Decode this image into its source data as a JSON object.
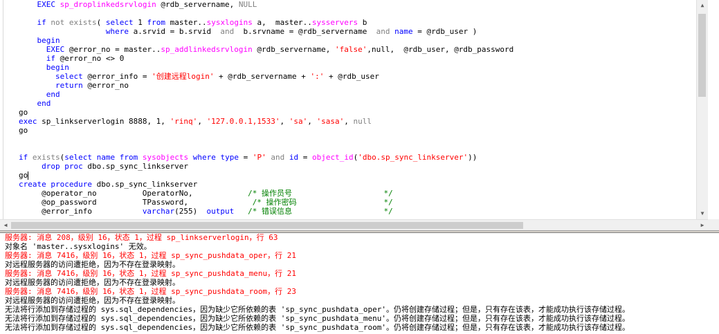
{
  "editor": {
    "lines": [
      [
        {
          "t": "    ",
          "c": "m"
        },
        {
          "t": "EXEC",
          "c": "k"
        },
        {
          "t": " ",
          "c": "m"
        },
        {
          "t": "sp_droplinkedsrvlogin",
          "c": "f"
        },
        {
          "t": " @rdb_servername, ",
          "c": "m"
        },
        {
          "t": "NULL",
          "c": "n"
        }
      ],
      [
        {
          "t": "",
          "c": "m"
        }
      ],
      [
        {
          "t": "    ",
          "c": "m"
        },
        {
          "t": "if",
          "c": "k"
        },
        {
          "t": " ",
          "c": "m"
        },
        {
          "t": "not exists",
          "c": "n"
        },
        {
          "t": "( ",
          "c": "m"
        },
        {
          "t": "select",
          "c": "k"
        },
        {
          "t": " 1 ",
          "c": "m"
        },
        {
          "t": "from",
          "c": "k"
        },
        {
          "t": " master..",
          "c": "m"
        },
        {
          "t": "sysxlogins",
          "c": "f"
        },
        {
          "t": " a,  master..",
          "c": "m"
        },
        {
          "t": "sysservers",
          "c": "f"
        },
        {
          "t": " b",
          "c": "m"
        }
      ],
      [
        {
          "t": "                   ",
          "c": "m"
        },
        {
          "t": "where",
          "c": "k"
        },
        {
          "t": " a.srvid = b.srvid  ",
          "c": "m"
        },
        {
          "t": "and",
          "c": "n"
        },
        {
          "t": "  b.srvname = @rdb_servername  ",
          "c": "m"
        },
        {
          "t": "and",
          "c": "n"
        },
        {
          "t": " ",
          "c": "m"
        },
        {
          "t": "name",
          "c": "k"
        },
        {
          "t": " = @rdb_user )",
          "c": "m"
        }
      ],
      [
        {
          "t": "    ",
          "c": "m"
        },
        {
          "t": "begin",
          "c": "k"
        }
      ],
      [
        {
          "t": "      ",
          "c": "m"
        },
        {
          "t": "EXEC",
          "c": "k"
        },
        {
          "t": " @error_no = master..",
          "c": "m"
        },
        {
          "t": "sp_addlinkedsrvlogin",
          "c": "f"
        },
        {
          "t": " @rdb_servername, ",
          "c": "m"
        },
        {
          "t": "'false'",
          "c": "s"
        },
        {
          "t": ",null,  @rdb_user, @rdb_password",
          "c": "m"
        }
      ],
      [
        {
          "t": "      ",
          "c": "m"
        },
        {
          "t": "if",
          "c": "k"
        },
        {
          "t": " @error_no <> 0",
          "c": "m"
        }
      ],
      [
        {
          "t": "      ",
          "c": "m"
        },
        {
          "t": "begin",
          "c": "k"
        }
      ],
      [
        {
          "t": "        ",
          "c": "m"
        },
        {
          "t": "select",
          "c": "k"
        },
        {
          "t": " @error_info = ",
          "c": "m"
        },
        {
          "t": "'创建远程login'",
          "c": "s"
        },
        {
          "t": " + @rdb_servername + ",
          "c": "m"
        },
        {
          "t": "':'",
          "c": "s"
        },
        {
          "t": " + @rdb_user",
          "c": "m"
        }
      ],
      [
        {
          "t": "        ",
          "c": "m"
        },
        {
          "t": "return",
          "c": "k"
        },
        {
          "t": " @error_no",
          "c": "m"
        }
      ],
      [
        {
          "t": "      ",
          "c": "m"
        },
        {
          "t": "end",
          "c": "k"
        }
      ],
      [
        {
          "t": "    ",
          "c": "m"
        },
        {
          "t": "end",
          "c": "k"
        }
      ],
      [
        {
          "t": "go",
          "c": "m"
        }
      ],
      [
        {
          "t": "exec",
          "c": "k"
        },
        {
          "t": " sp_linkserverlogin 8888, 1, ",
          "c": "m"
        },
        {
          "t": "'rinq'",
          "c": "s"
        },
        {
          "t": ", ",
          "c": "m"
        },
        {
          "t": "'127.0.0.1,1533'",
          "c": "s"
        },
        {
          "t": ", ",
          "c": "m"
        },
        {
          "t": "'sa'",
          "c": "s"
        },
        {
          "t": ", ",
          "c": "m"
        },
        {
          "t": "'sasa'",
          "c": "s"
        },
        {
          "t": ", ",
          "c": "m"
        },
        {
          "t": "null",
          "c": "n"
        }
      ],
      [
        {
          "t": "go",
          "c": "m"
        }
      ],
      [
        {
          "t": "",
          "c": "m"
        }
      ],
      [
        {
          "t": "",
          "c": "m"
        }
      ],
      [
        {
          "t": "if",
          "c": "k"
        },
        {
          "t": " ",
          "c": "m"
        },
        {
          "t": "exists",
          "c": "n"
        },
        {
          "t": "(",
          "c": "m"
        },
        {
          "t": "select",
          "c": "k"
        },
        {
          "t": " ",
          "c": "m"
        },
        {
          "t": "name",
          "c": "k"
        },
        {
          "t": " ",
          "c": "m"
        },
        {
          "t": "from",
          "c": "k"
        },
        {
          "t": " ",
          "c": "m"
        },
        {
          "t": "sysobjects",
          "c": "f"
        },
        {
          "t": " ",
          "c": "m"
        },
        {
          "t": "where",
          "c": "k"
        },
        {
          "t": " ",
          "c": "m"
        },
        {
          "t": "type",
          "c": "k"
        },
        {
          "t": " = ",
          "c": "m"
        },
        {
          "t": "'P'",
          "c": "s"
        },
        {
          "t": " ",
          "c": "m"
        },
        {
          "t": "and",
          "c": "n"
        },
        {
          "t": " ",
          "c": "m"
        },
        {
          "t": "id",
          "c": "k"
        },
        {
          "t": " = ",
          "c": "m"
        },
        {
          "t": "object_id",
          "c": "f"
        },
        {
          "t": "(",
          "c": "m"
        },
        {
          "t": "'dbo.sp_sync_linkserver'",
          "c": "s"
        },
        {
          "t": "))",
          "c": "m"
        }
      ],
      [
        {
          "t": "     ",
          "c": "m"
        },
        {
          "t": "drop proc",
          "c": "k"
        },
        {
          "t": " dbo.sp_sync_linkserver",
          "c": "m"
        }
      ],
      [
        {
          "t": "go",
          "c": "m"
        },
        {
          "t": "",
          "c": "caret"
        }
      ],
      [
        {
          "t": "create procedure",
          "c": "k"
        },
        {
          "t": " dbo.sp_sync_linkserver",
          "c": "m"
        }
      ],
      [
        {
          "t": "     @operator_no          OperatorNo,            ",
          "c": "m"
        },
        {
          "t": "/* 操作员号                    */",
          "c": "c"
        }
      ],
      [
        {
          "t": "     @op_password          TPassword,              ",
          "c": "m"
        },
        {
          "t": "/* 操作密码                   */",
          "c": "c"
        }
      ],
      [
        {
          "t": "     @error_info           ",
          "c": "m"
        },
        {
          "t": "varchar",
          "c": "k"
        },
        {
          "t": "(255)  ",
          "c": "m"
        },
        {
          "t": "output",
          "c": "k"
        },
        {
          "t": "   ",
          "c": "m"
        },
        {
          "t": "/* 错误信息                    */",
          "c": "c"
        }
      ]
    ]
  },
  "output": {
    "lines": [
      {
        "t": "服务器: 消息 208，级别 16，状态 1，过程 sp_linkserverlogin，行 63",
        "c": "err"
      },
      {
        "t": "对象名 'master..sysxlogins' 无效。",
        "c": "txt"
      },
      {
        "t": "服务器: 消息 7416，级别 16，状态 1，过程 sp_sync_pushdata_oper，行 21",
        "c": "err"
      },
      {
        "t": "对远程服务器的访问遭拒绝，因为不存在登录映射。",
        "c": "txt"
      },
      {
        "t": "服务器: 消息 7416，级别 16，状态 1，过程 sp_sync_pushdata_menu，行 21",
        "c": "err"
      },
      {
        "t": "对远程服务器的访问遭拒绝，因为不存在登录映射。",
        "c": "txt"
      },
      {
        "t": "服务器: 消息 7416，级别 16，状态 1，过程 sp_sync_pushdata_room，行 23",
        "c": "err"
      },
      {
        "t": "对远程服务器的访问遭拒绝，因为不存在登录映射。",
        "c": "txt"
      },
      {
        "t": "无法将行添加到存储过程的 sys.sql_dependencies，因为缺少它所依赖的表 'sp_sync_pushdata_oper'。仍将创建存储过程；但是，只有存在该表，才能成功执行该存储过程。",
        "c": "txt"
      },
      {
        "t": "无法将行添加到存储过程的 sys.sql_dependencies，因为缺少它所依赖的表 'sp_sync_pushdata_menu'。仍将创建存储过程；但是，只有存在该表，才能成功执行该存储过程。",
        "c": "txt"
      },
      {
        "t": "无法将行添加到存储过程的 sys.sql_dependencies，因为缺少它所依赖的表 'sp_sync_pushdata_room'。仍将创建存储过程；但是，只有存在该表，才能成功执行该存储过程。",
        "c": "txt"
      }
    ]
  },
  "colors": {
    "keyword": "#0000ff",
    "function": "#ff00ff",
    "string": "#ff0000",
    "operator_word": "#808080",
    "comment": "#008000",
    "error": "#ff0000"
  },
  "icons": {
    "scroll_up": "triangle-up",
    "scroll_down": "triangle-down",
    "scroll_left": "triangle-left",
    "scroll_right": "triangle-right"
  }
}
